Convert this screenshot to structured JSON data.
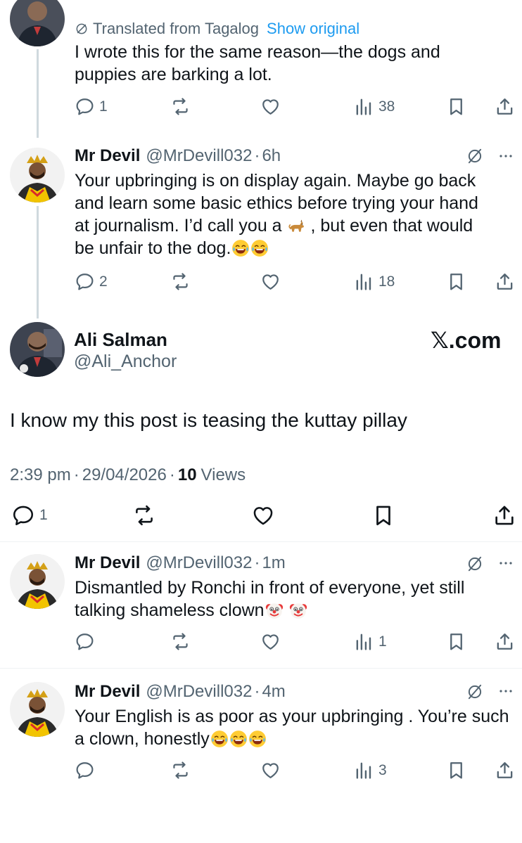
{
  "top_reply": {
    "translated_label": "Translated from Tagalog",
    "show_original": "Show original",
    "text": "I wrote this for the same reason—the dogs and puppies are barking a lot.",
    "replies": "1",
    "views": "38"
  },
  "reply1": {
    "name": "Mr Devil",
    "handle": "@MrDevill032",
    "sep": "·",
    "time": "6h",
    "lines": [
      "Your upbringing is on display again. Maybe go back",
      "and learn some basic ethics before trying your hand",
      "at journalism. I’d call you a",
      ", but even that would",
      "be unfair to the dog."
    ],
    "replies": "2",
    "views": "18"
  },
  "main_post": {
    "name": "Ali Salman",
    "handle": "@Ali_Anchor",
    "watermark": "𝕏.com",
    "text": "I know my this post is teasing the kuttay pillay",
    "time": "2:39 pm",
    "sep1": "·",
    "date": "29/04/2026",
    "sep2": "·",
    "views_count": "10",
    "views_label": "Views",
    "replies": "1"
  },
  "reply2": {
    "name": "Mr Devil",
    "handle": "@MrDevill032",
    "sep": "·",
    "time": "1m",
    "lines": [
      "Dismantled by Ronchi in front of everyone, yet still",
      "talking shameless clown"
    ],
    "views": "1"
  },
  "reply3": {
    "name": "Mr Devil",
    "handle": "@MrDevill032",
    "sep": "·",
    "time": "4m",
    "lines": [
      "Your English is as poor as your upbringing . You’re such",
      "a clown, honestly"
    ],
    "views": "3"
  },
  "colors": {
    "text": "#0f1419",
    "muted": "#536471",
    "link": "#1d9bf0",
    "thread_line": "#cfd9de",
    "divider": "#eff3f4"
  },
  "icons": {
    "reply": "reply-icon",
    "repost": "repost-icon",
    "like": "heart-icon",
    "views": "views-icon",
    "bookmark": "bookmark-icon",
    "share": "share-icon",
    "translate": "translate-icon",
    "grok": "grok-icon",
    "more": "more-icon"
  }
}
